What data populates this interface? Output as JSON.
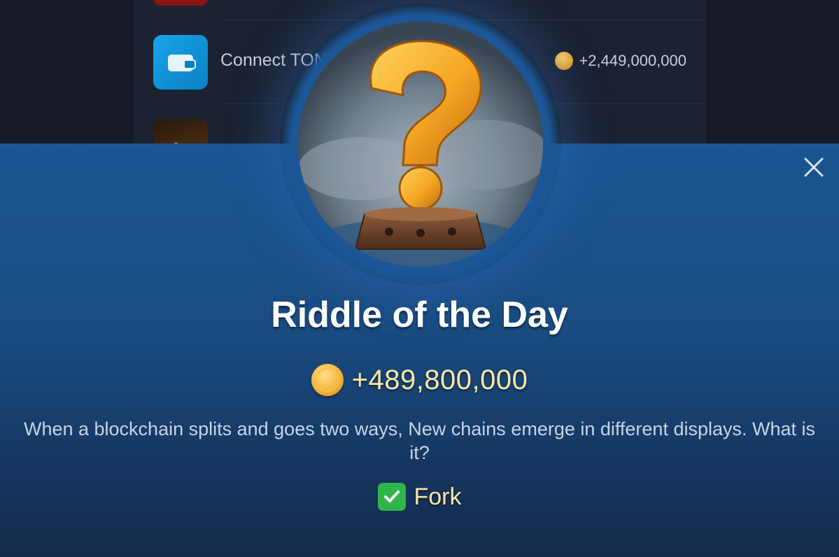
{
  "background_tasks": [
    {
      "title": "Connect TON",
      "reward": "+2,449,000,000",
      "icon": "wallet-icon"
    },
    {
      "title": "",
      "reward": "",
      "icon": "chart-icon"
    }
  ],
  "modal": {
    "title": "Riddle of the Day",
    "reward": "+489,800,000",
    "riddle": "When a blockchain splits and goes two ways, New chains emerge in different displays. What is it?",
    "answer": "Fork",
    "icons": {
      "close": "close-icon",
      "hero": "question-mark-icon",
      "coin": "coin-icon",
      "check": "check-icon"
    }
  },
  "colors": {
    "sheet_top": "#1a5591",
    "sheet_bottom": "#142a48",
    "accent_gold": "#fbe7a4",
    "check_green": "#2fb54a"
  }
}
